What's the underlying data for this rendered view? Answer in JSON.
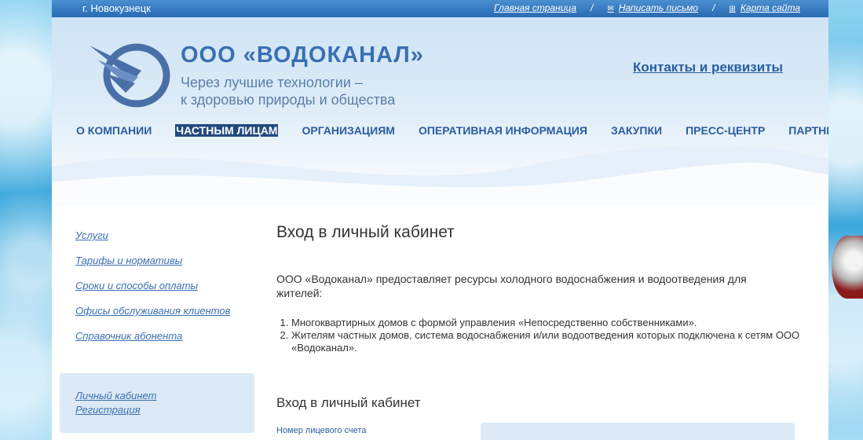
{
  "topbar": {
    "city": "г. Новокузнецк",
    "home_link": "Главная страница",
    "write_link": "Написать письмо",
    "sitemap_link": "Карта сайта",
    "separator": "/"
  },
  "header": {
    "brand": "ООО «ВОДОКАНАЛ»",
    "slogan_line1": "Через лучшие технологии –",
    "slogan_line2": "к здоровью природы и общества",
    "contacts_link": "Контакты и реквизиты"
  },
  "nav": {
    "items": [
      "О КОМПАНИИ",
      "ЧАСТНЫМ ЛИЦАМ",
      "ОРГАНИЗАЦИЯМ",
      "ОПЕРАТИВНАЯ ИНФОРМАЦИЯ",
      "ЗАКУПКИ",
      "ПРЕСС-ЦЕНТР",
      "ПАРТНЕРЫ"
    ],
    "active": "ЧАСТНЫМ ЛИЦАМ"
  },
  "sidebar": {
    "items": [
      "Услуги",
      "Тарифы и нормативы",
      "Сроки и способы оплаты",
      "Офисы обслуживания клиентов",
      "Справочник абонента"
    ],
    "box": {
      "cabinet_link": "Личный кабинет",
      "register_link": "Регистрация"
    }
  },
  "main": {
    "title": "Вход в личный кабинет",
    "intro": "ООО «Водоканал» предоставляет ресурсы холодного водоснабжения и водоотведения для жителей:",
    "list": [
      "Многоквартирных домов с формой управления «Непосредственно собственниками».",
      "Жителям частных домов, система водоснабжения и/или водоотведения которых подключена к сетям ООО «Водоканал»."
    ],
    "login_heading": "Вход в личный кабинет",
    "account_label": "Номер лицевого счета"
  }
}
